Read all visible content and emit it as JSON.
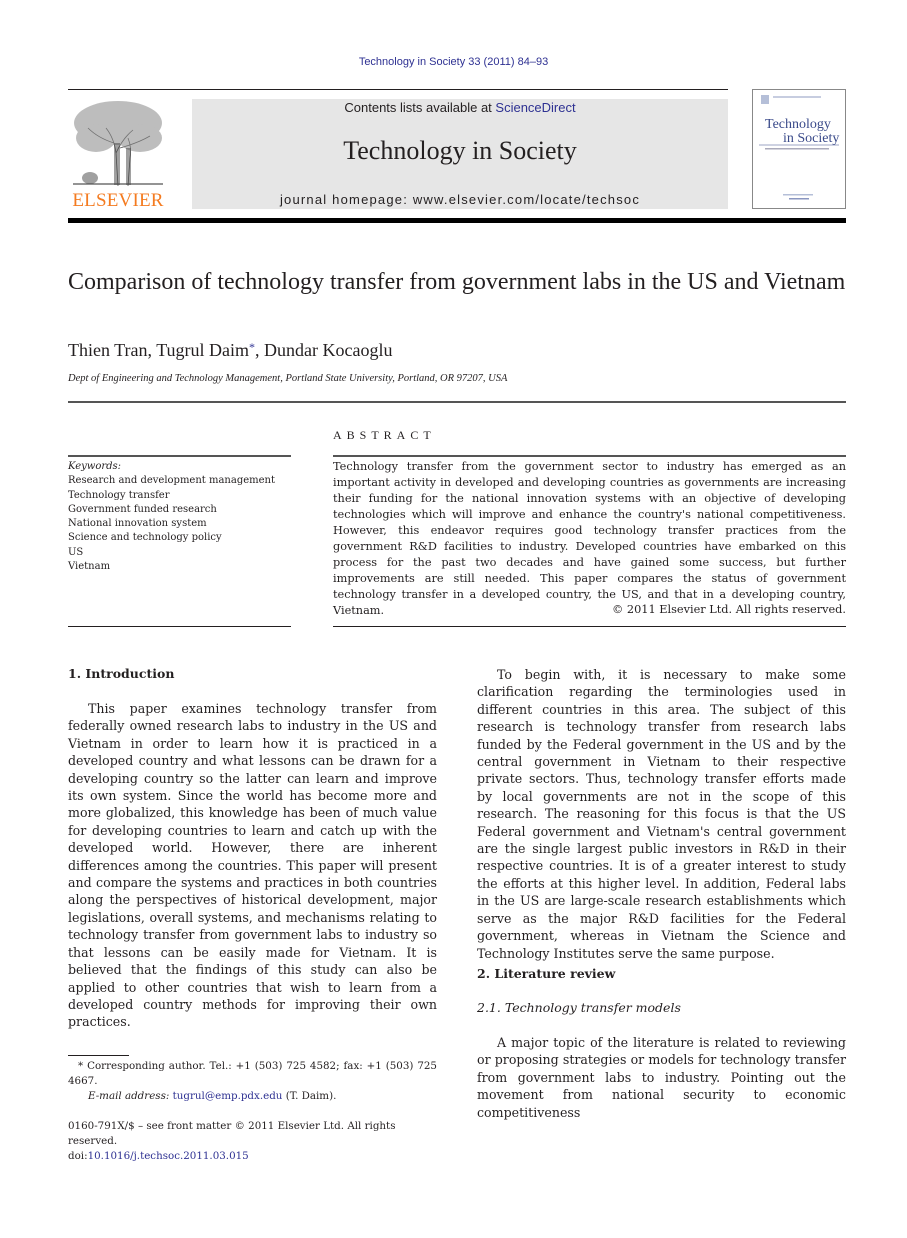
{
  "header": {
    "journal_ref": "Technology in Society 33 (2011) 84–93",
    "contents_prefix": "Contents lists available at ",
    "contents_link": "ScienceDirect",
    "journal_title": "Technology in Society",
    "homepage": "journal homepage: www.elsevier.com/locate/techsoc",
    "publisher_logo_text": "ELSEVIER",
    "cover": {
      "title_line1": "Technology",
      "title_line2": "in Society"
    },
    "colors": {
      "link_blue": "#2e3192",
      "elsevier_orange": "#f47b20",
      "masthead_gray": "#e6e6e6"
    }
  },
  "article": {
    "title": "Comparison of technology transfer from government labs in the US and Vietnam",
    "authors": {
      "author1": "Thien Tran, ",
      "author2": "Tugrul Daim",
      "corresponding_mark": "*",
      "author3": ", Dundar Kocaoglu"
    },
    "affiliation": "Dept of Engineering and Technology Management, Portland State University, Portland, OR 97207, USA"
  },
  "keywords": {
    "label": "Keywords:",
    "items": [
      "Research and development management",
      "Technology transfer",
      "Government funded research",
      "National innovation system",
      "Science and technology policy",
      "US",
      "Vietnam"
    ]
  },
  "abstract": {
    "heading": "ABSTRACT",
    "text": "Technology transfer from the government sector to industry has emerged as an important activity in developed and developing countries as governments are increasing their funding for the national innovation systems with an objective of developing technologies which will improve and enhance the country's national competitiveness. However, this endeavor requires good technology transfer practices from the government R&D facilities to industry. Developed countries have embarked on this process for the past two decades and have gained some success, but further improvements are still needed. This paper compares the status of government technology transfer in a developed country, the US, and that in a developing country, Vietnam.",
    "copyright": "© 2011 Elsevier Ltd. All rights reserved."
  },
  "body": {
    "sec1_heading": "1.  Introduction",
    "sec1_para1": "This paper examines technology transfer from federally owned research labs to industry in the US and Vietnam in order to learn how it is practiced in a developed country and what lessons can be drawn for a developing country so the latter can learn and improve its own system. Since the world has become more and more globalized, this knowledge has been of much value for developing countries to learn and catch up with the developed world. However, there are inherent differences among the countries. This paper will present and compare the systems and practices in both countries along the perspectives of historical development, major legislations, overall systems, and mechanisms relating to technology transfer from government labs to industry so that lessons can be easily made for Vietnam. It is believed that the findings of this study can also be applied to other countries that wish to learn from a developed country methods for improving their own practices.",
    "col2_para1": "To begin with, it is necessary to make some clarification regarding the terminologies used in different countries in this area. The subject of this research is technology transfer from research labs funded by the Federal government in the US and by the central government in Vietnam to their respective private sectors. Thus, technology transfer efforts made by local governments are not in the scope of this research. The reasoning for this focus is that the US Federal government and Vietnam's central government are the single largest public investors in R&D in their respective countries. It is of a greater interest to study the efforts at this higher level. In addition, Federal labs in the US are large-scale research establishments which serve as the major R&D facilities for the Federal government, whereas in Vietnam the Science and Technology Institutes serve the same purpose.",
    "sec2_heading": "2.  Literature review",
    "sec21_heading": "2.1.  Technology transfer models",
    "sec21_para1": "A major topic of the literature is related to reviewing or proposing strategies or models for technology transfer from government labs to industry. Pointing out the movement from national security to economic competitiveness"
  },
  "footnote": {
    "corresponding": "* Corresponding author. Tel.: +1 (503) 725 4582; fax: +1 (503) 725 4667.",
    "email_label": "E-mail address: ",
    "email": "tugrul@emp.pdx.edu",
    "email_suffix": " (T. Daim).",
    "front_matter": "0160-791X/$ – see front matter © 2011 Elsevier Ltd. All rights reserved.",
    "doi_prefix": "doi:",
    "doi": "10.1016/j.techsoc.2011.03.015"
  }
}
